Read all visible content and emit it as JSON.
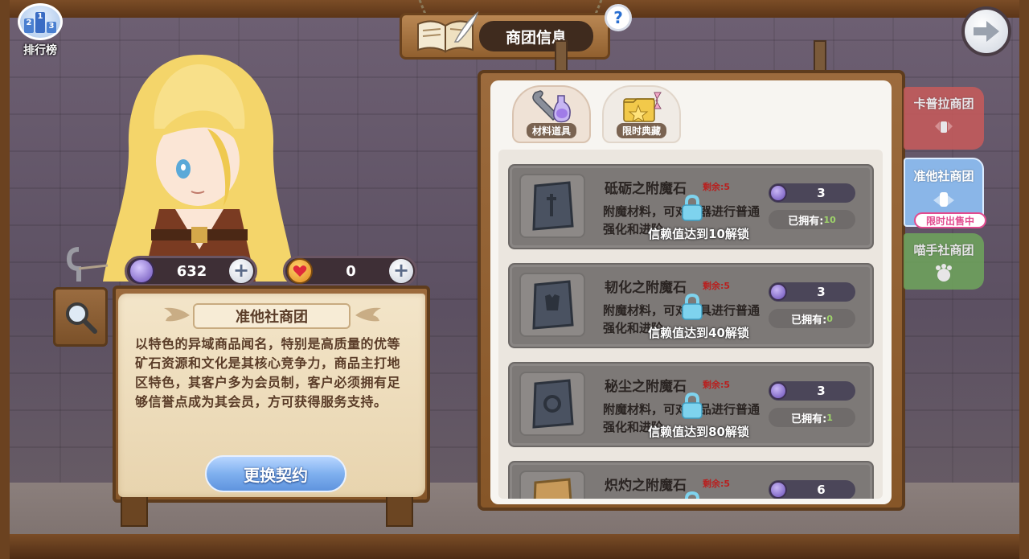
{
  "top_left": {
    "rank_label": "排行榜",
    "rank_digits": [
      "2",
      "1",
      "3"
    ]
  },
  "title": {
    "text": "商团信息",
    "help": "?"
  },
  "resources": {
    "gem": {
      "value": "632",
      "plus": "+"
    },
    "heart": {
      "value": "0",
      "plus": "+"
    }
  },
  "guild": {
    "name": "准他社商团",
    "description": "以特色的异域商品闻名，特别是高质量的优等矿石资源和文化是其核心竞争力，商品主打地区特色，其客户多为会员制，客户必须拥有足够信誉点成为其会员，方可获得服务支持。",
    "change_button": "更换契约"
  },
  "tabs": [
    {
      "label": "材料道具",
      "active": true
    },
    {
      "label": "限时典藏",
      "active": false
    }
  ],
  "items": [
    {
      "name": "砥砺之附魔石",
      "remain_label": "剩余:",
      "remain": "5",
      "desc": "附魔材料，可对武器进行普通强化和进阶",
      "price": "3",
      "owned_label": "已拥有:",
      "owned": "10",
      "lock_text": "信赖值达到10解锁"
    },
    {
      "name": "韧化之附魔石",
      "remain_label": "剩余:",
      "remain": "5",
      "desc": "附魔材料，可对防具进行普通强化和进阶",
      "price": "3",
      "owned_label": "已拥有:",
      "owned": "0",
      "lock_text": "信赖值达到40解锁"
    },
    {
      "name": "秘尘之附魔石",
      "remain_label": "剩余:",
      "remain": "5",
      "desc": "附魔材料，可对饰品进行普通强化和进阶",
      "price": "3",
      "owned_label": "已拥有:",
      "owned": "1",
      "lock_text": "信赖值达到80解锁"
    },
    {
      "name": "炽灼之附魔石",
      "remain_label": "剩余:",
      "remain": "5",
      "desc": "",
      "price": "6",
      "owned_label": "",
      "owned": "",
      "lock_text": ""
    }
  ],
  "side_guilds": [
    {
      "label": "卡普拉商团",
      "color": "#c85b5b"
    },
    {
      "label": "准他社商团",
      "color": "#8ab6e8",
      "tag": "限时出售中"
    },
    {
      "label": "喵手社商团",
      "color": "#6fa65c"
    }
  ]
}
